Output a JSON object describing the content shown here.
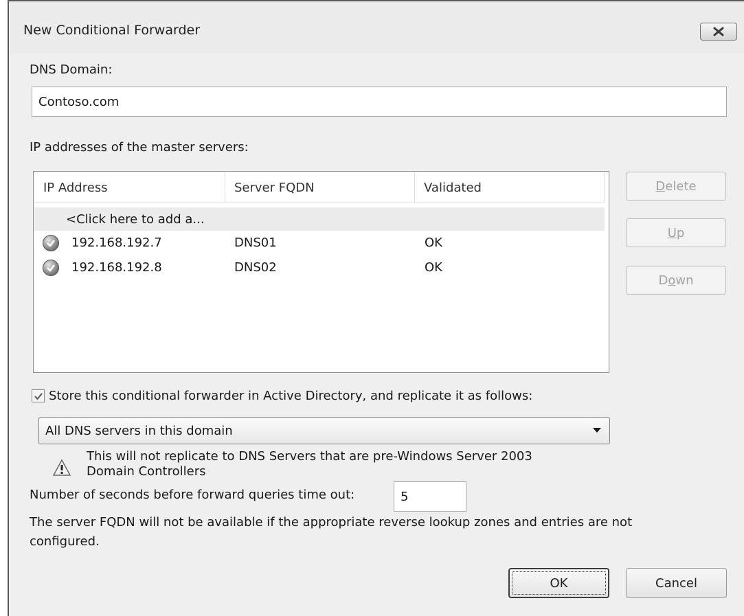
{
  "window": {
    "title": "New Conditional Forwarder"
  },
  "dns_domain": {
    "label": "DNS Domain:",
    "value": "Contoso.com"
  },
  "master_servers": {
    "label": "IP addresses of the master servers:",
    "columns": [
      "IP Address",
      "Server FQDN",
      "Validated"
    ],
    "add_row_text": "<Click here to add a...",
    "rows": [
      {
        "ip": "192.168.192.7",
        "fqdn": "DNS01",
        "validated": "OK"
      },
      {
        "ip": "192.168.192.8",
        "fqdn": "DNS02",
        "validated": "OK"
      }
    ]
  },
  "side_buttons": {
    "delete": {
      "first": "D",
      "rest": "elete"
    },
    "up": {
      "first": "U",
      "rest": "p"
    },
    "down": {
      "pre": "D",
      "ul": "o",
      "post": "wn"
    }
  },
  "store_ad": {
    "label": "Store this conditional forwarder in Active Directory, and replicate it as follows:",
    "checked": true
  },
  "replication": {
    "selected": "All DNS servers in this domain"
  },
  "warning": {
    "line1": "This will not replicate to DNS Servers that are pre-Windows Server 2003",
    "line2": "Domain Controllers"
  },
  "timeout": {
    "label": "Number of seconds before forward queries time out:",
    "value": "5"
  },
  "note": {
    "line1": "The server FQDN will not be available if the appropriate reverse lookup zones and entries are not",
    "line2": "configured."
  },
  "footer": {
    "ok": "OK",
    "cancel": "Cancel"
  },
  "icons": {
    "close": "close-icon",
    "validated": "check-circle-icon",
    "warning": "warning-icon",
    "dropdown": "chevron-down-icon"
  }
}
